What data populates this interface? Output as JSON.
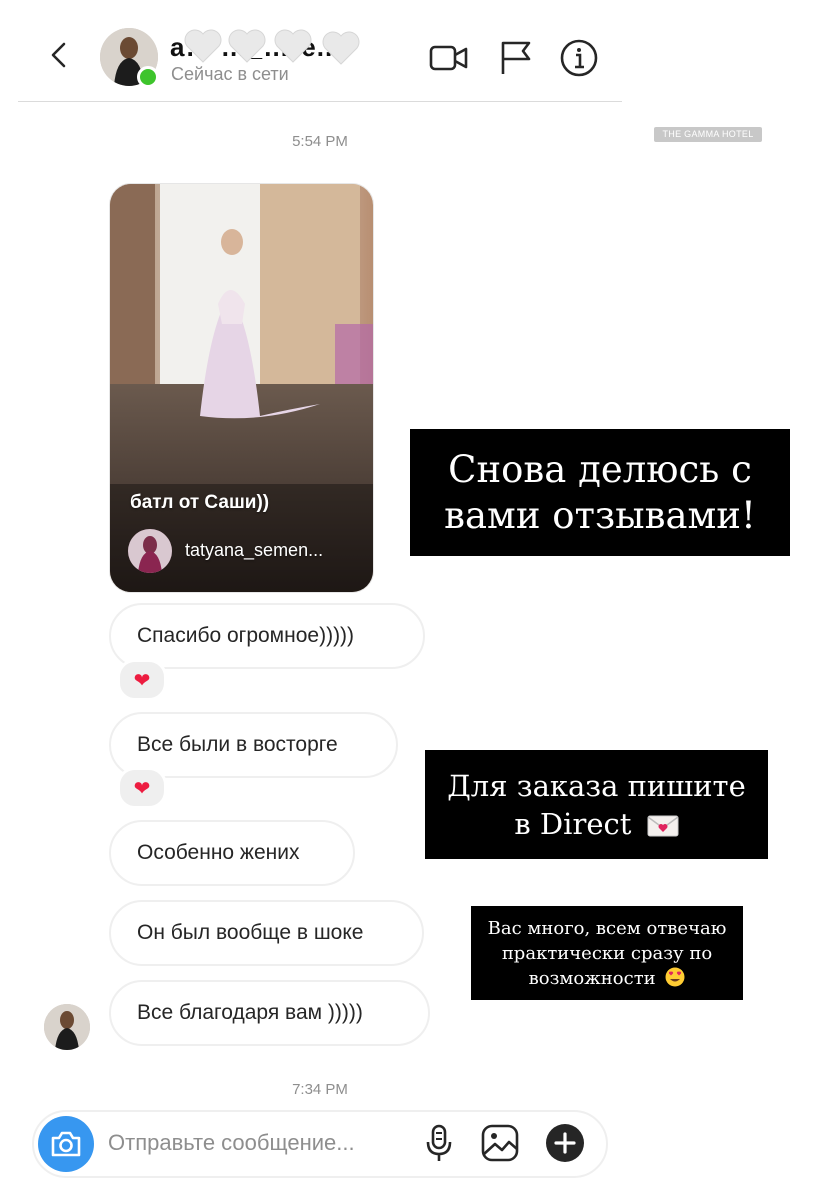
{
  "header": {
    "user_name": "a… …_…re...",
    "status": "Сейчас в сети",
    "icons": [
      "back-icon",
      "video-call-icon",
      "flag-icon",
      "info-icon"
    ]
  },
  "watermark": "THE GAMMA HOTEL",
  "timestamps": {
    "first": "5:54 PM",
    "second": "7:34 PM"
  },
  "story": {
    "caption": "батл от Саши))",
    "username": "tatyana_semen..."
  },
  "messages": [
    {
      "text": "Спасибо огромное)))))",
      "reaction": "heart"
    },
    {
      "text": "Все были в восторге",
      "reaction": "heart"
    },
    {
      "text": "Особенно жених"
    },
    {
      "text": "Он был вообще в шоке"
    },
    {
      "text": "Все благодаря вам )))))"
    }
  ],
  "overlay_labels": {
    "label1_line1": "Снова делюсь с",
    "label1_line2": "вами отзывами!",
    "label2_line1": "Для заказа пишите",
    "label2_line2": "в Direct",
    "label3_line1": "Вас много, всем отвечаю",
    "label3_line2": "практически сразу по",
    "label3_line3": "возможности"
  },
  "composer": {
    "placeholder": "Отправьте сообщение...",
    "icons": [
      "camera-icon",
      "microphone-icon",
      "gallery-icon",
      "plus-icon"
    ]
  },
  "colors": {
    "online": "#3ec42c",
    "camera_button": "#3797f0",
    "reaction_heart": "#ed1c40",
    "bubble_border": "#efefef",
    "overlay_bg": "#000000"
  }
}
